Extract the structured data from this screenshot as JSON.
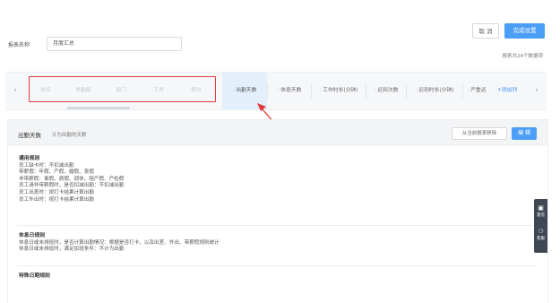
{
  "header": {
    "cancel_label": "取 消",
    "done_label": "完成设置",
    "report_name_label": "报表名称",
    "report_name_value": "月度汇总",
    "report_count": "报表共24个数据项"
  },
  "columns": {
    "prev_icon": "chevron-left-icon",
    "next_icon": "chevron-right-icon",
    "items": [
      {
        "label": "姓名"
      },
      {
        "label": "考勤组"
      },
      {
        "label": "部门"
      },
      {
        "label": "工号"
      },
      {
        "label": "职位"
      },
      {
        "label": "出勤天数"
      },
      {
        "label": "休息天数"
      },
      {
        "label": "工作时长(分钟)"
      },
      {
        "label": "迟到次数"
      },
      {
        "label": "迟到时长(分钟)"
      },
      {
        "label": "严重迟"
      }
    ],
    "add_label": "+添加列"
  },
  "detail": {
    "field_name": "出勤天数",
    "field_desc": "计为出勤的天数",
    "remove_label": "从当前报表移除",
    "edit_label": "编 辑",
    "sections": [
      {
        "title": "通用规则",
        "lines": [
          "员工缺卡时：不扣减出勤",
          "带薪假：年假、产假、婚假、丧假",
          "非带薪假：事假、病假、调休、陪产假、产检假",
          "员工请非带薪假时，是否扣减出勤：不扣减出勤",
          "员工出差时：按打卡结果计算出勤",
          "员工外出时：按打卡结果计算出勤"
        ]
      },
      {
        "title": "休息日规则",
        "lines": [
          "休息日或未排班时，是否计算出勤情况：根据是否打卡，以及出差、外出、带薪假规则统计",
          "休息日或未排班时，满足加班条件：不计为出勤"
        ]
      },
      {
        "title": "特殊日期规则",
        "lines": []
      }
    ]
  },
  "side_tools": [
    {
      "icon": "feedback-icon",
      "label": "意见"
    },
    {
      "icon": "help-icon",
      "label": "客服"
    }
  ]
}
